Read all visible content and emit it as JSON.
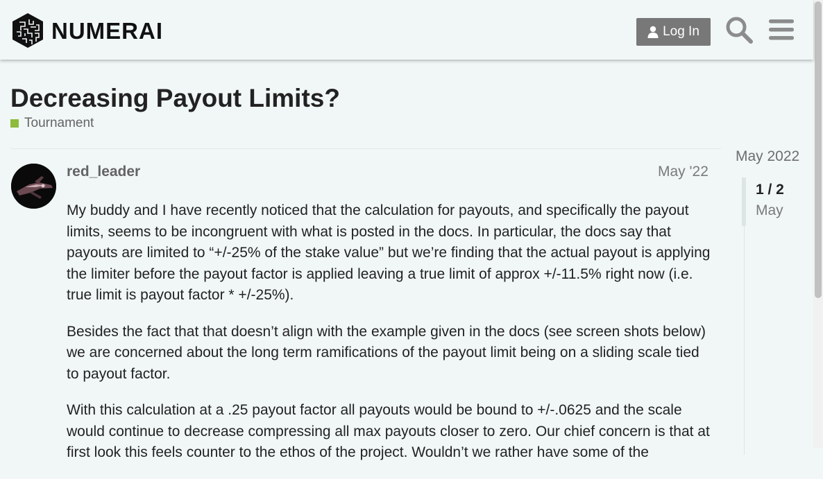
{
  "brand": {
    "name": "NUMERAI",
    "logo_icon": "numerai-logo-icon"
  },
  "header": {
    "login_label": "Log In",
    "login_icon": "user-icon",
    "search_icon": "search-icon",
    "menu_icon": "hamburger-menu-icon"
  },
  "topic": {
    "title": "Decreasing Payout Limits?",
    "category": "Tournament",
    "category_color": "#8dbb3b"
  },
  "post": {
    "username": "red_leader",
    "date": "May '22",
    "paragraphs": [
      "My buddy and I have recently noticed that the calculation for payouts, and specifically the payout limits, seems to be incongruent with what is posted in the docs. In particular, the docs say that payouts are limited to “+/-25% of the stake value” but we’re finding that the actual payout is applying the limiter before the payout factor is applied leaving a true limit of approx +/-11.5% right now (i.e. true limit is payout factor * +/-25%).",
      "Besides the fact that that doesn’t align with the example given in the docs (see screen shots below) we are concerned about the long term ramifications of the payout limit being on a sliding scale tied to payout factor.",
      "With this calculation at a .25 payout factor all payouts would be bound to +/-.0625 and the scale would continue to decrease compressing all max payouts closer to zero. Our chief concern is that at first look this feels counter to the ethos of the project. Wouldn’t we rather have some of the"
    ]
  },
  "timeline": {
    "top_date": "May 2022",
    "counter": "1 / 2",
    "current_date": "May"
  },
  "colors": {
    "background": "#f1f7f7",
    "button": "#787878",
    "accent": "#8dbb3b"
  }
}
